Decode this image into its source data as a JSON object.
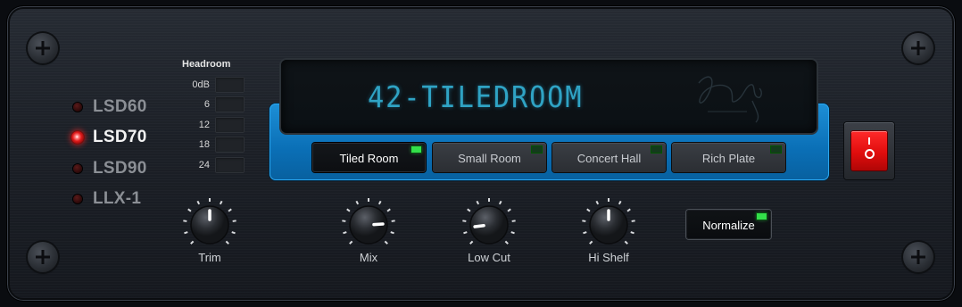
{
  "models": [
    {
      "label": "LSD60",
      "active": false
    },
    {
      "label": "LSD70",
      "active": true
    },
    {
      "label": "LSD90",
      "active": false
    },
    {
      "label": "LLX-1",
      "active": false
    }
  ],
  "headroom": {
    "title": "Headroom",
    "levels": [
      "0dB",
      "6",
      "12",
      "18",
      "24"
    ]
  },
  "display": {
    "preset_text": "42-TILEDROOM"
  },
  "presets": [
    {
      "label": "Tiled Room",
      "active": true
    },
    {
      "label": "Small Room",
      "active": false
    },
    {
      "label": "Concert Hall",
      "active": false
    },
    {
      "label": "Rich Plate",
      "active": false
    }
  ],
  "knobs": [
    {
      "label": "Trim",
      "value": 0.5
    },
    {
      "label": "Mix",
      "value": 0.82
    },
    {
      "label": "Low Cut",
      "value": 0.14
    },
    {
      "label": "Hi Shelf",
      "value": 0.5
    }
  ],
  "normalize": {
    "label": "Normalize",
    "on": true
  },
  "power": {
    "on": true
  },
  "colors": {
    "display_text": "#2fa3c4",
    "accent_blue": "#0a6fb6",
    "led_on_red": "#e01a1a",
    "led_on_green": "#33e04a",
    "power_red": "#e00d0d"
  }
}
